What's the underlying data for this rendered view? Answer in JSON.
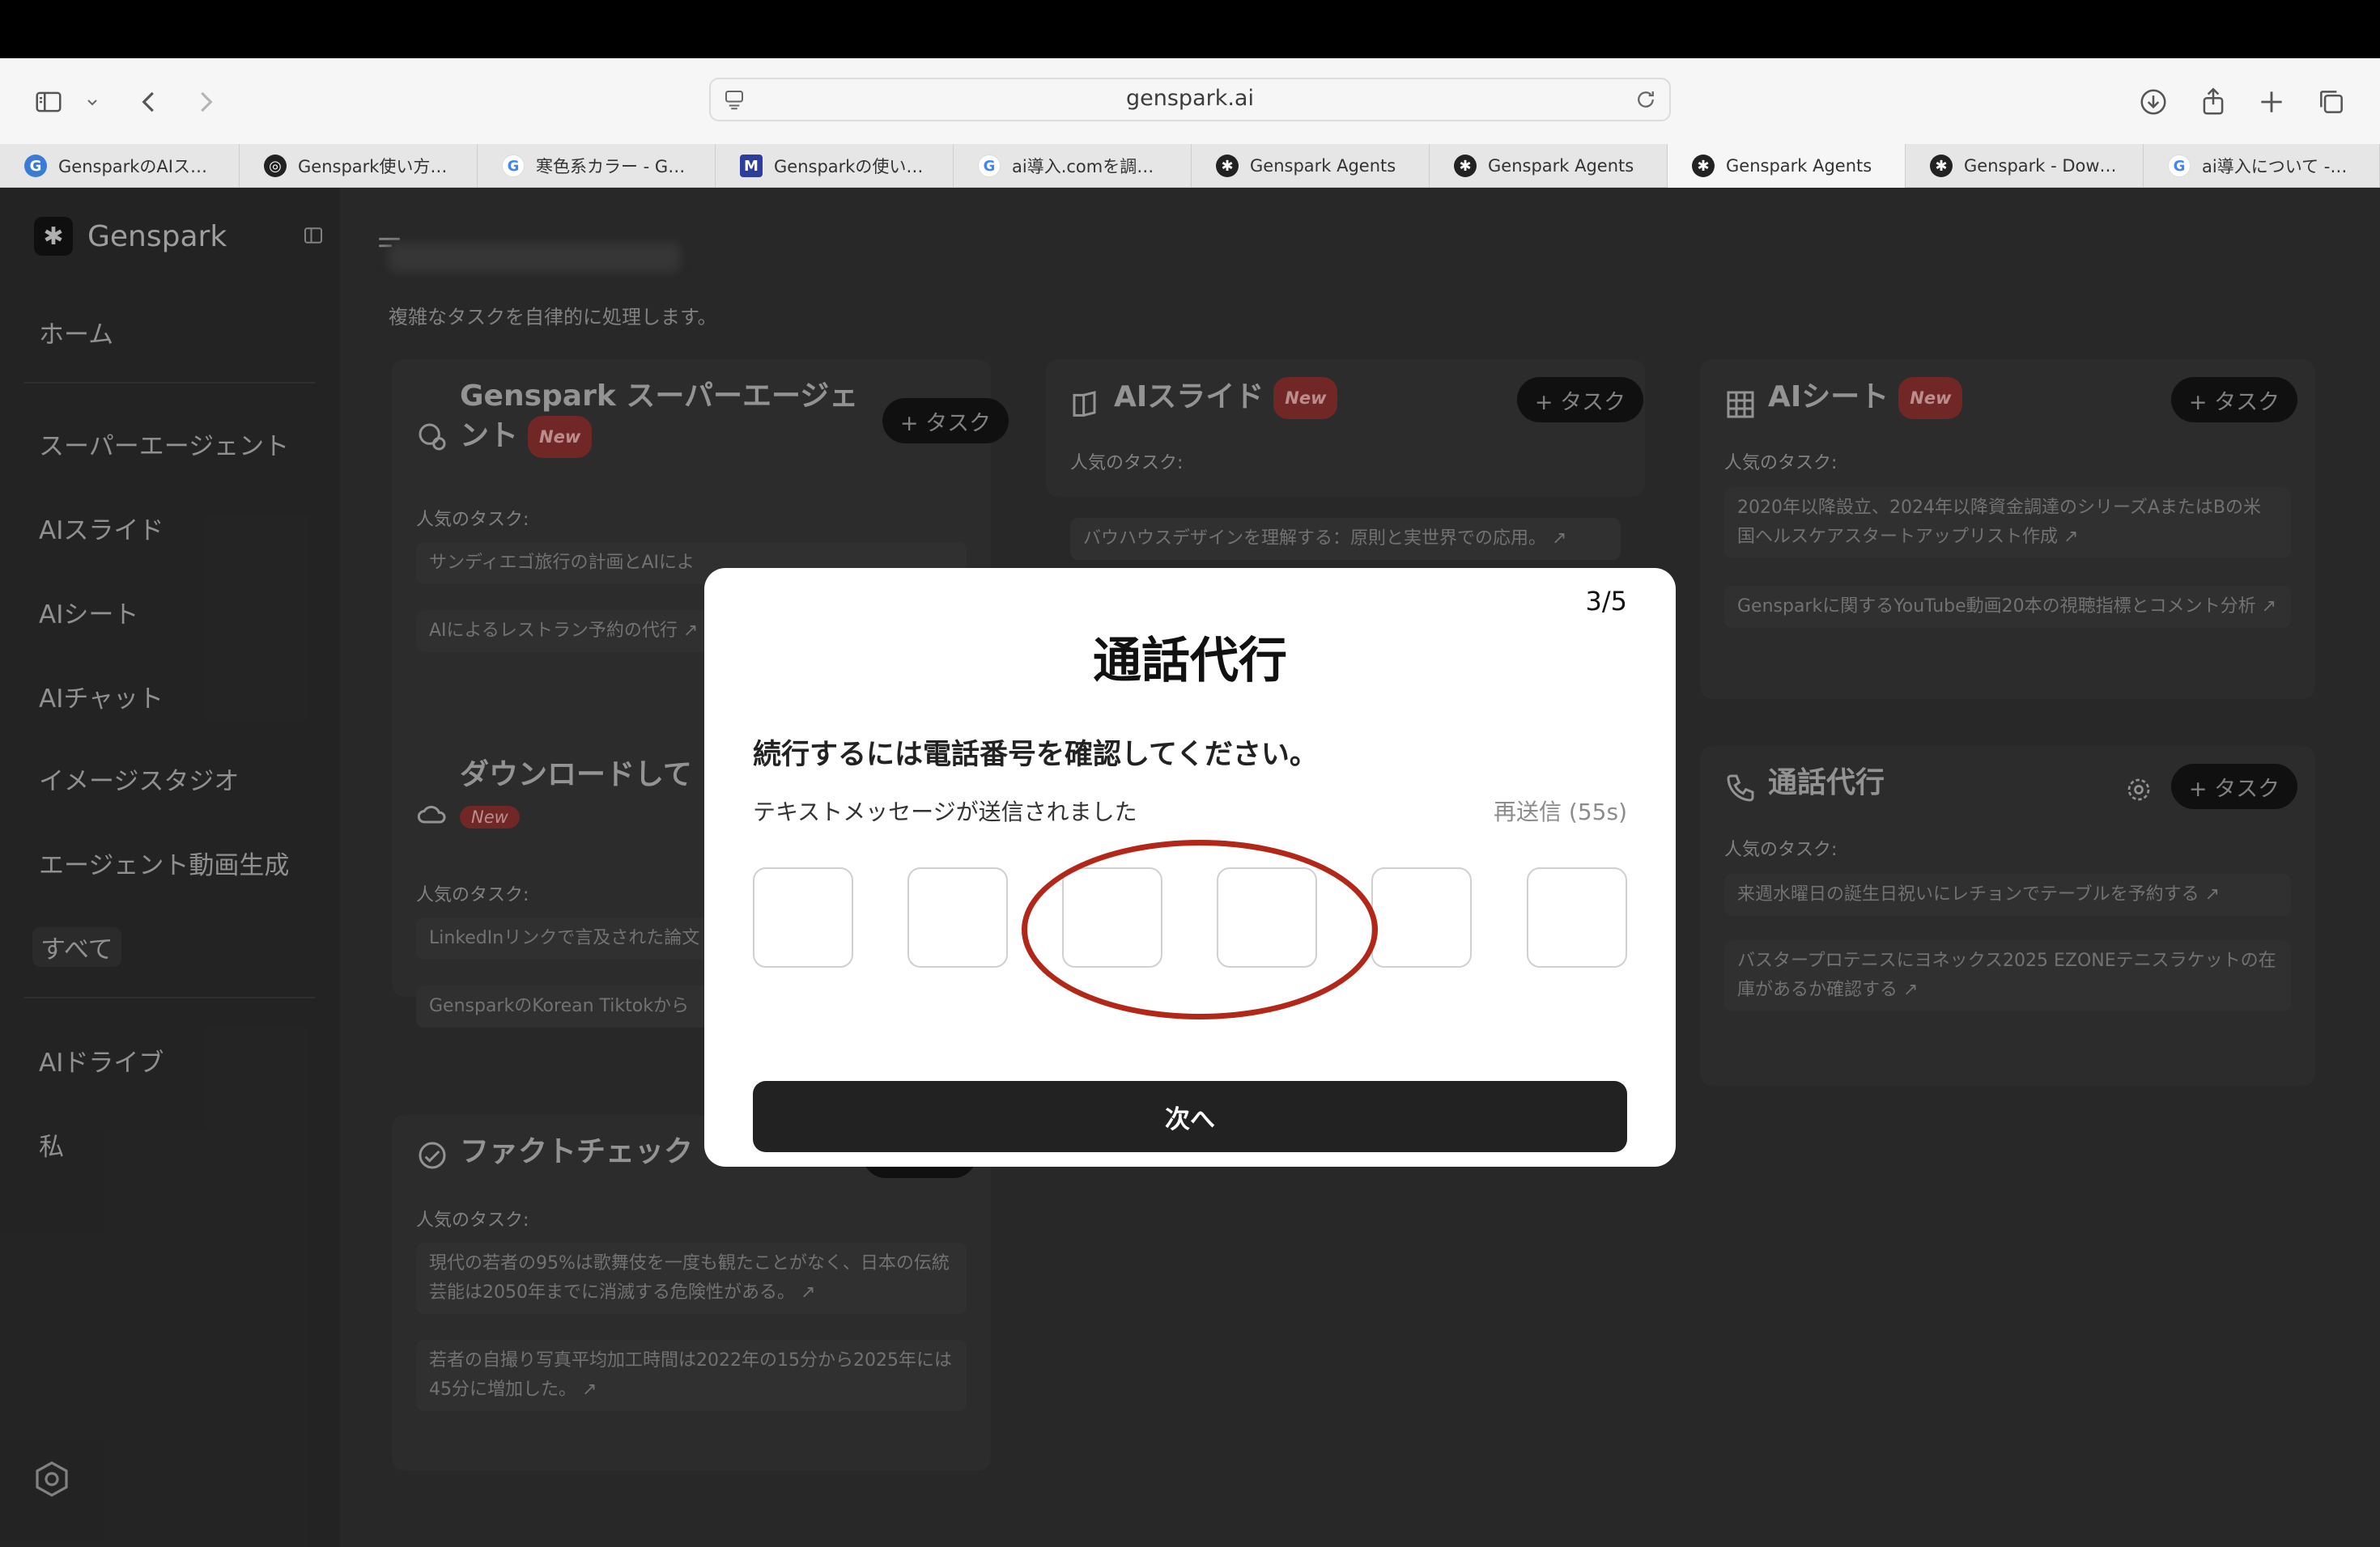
{
  "browser": {
    "url": "genspark.ai",
    "tabs": [
      {
        "title": "GensparkのAIス…",
        "icon": "genspark-doc-icon",
        "color": "#3a7bd5"
      },
      {
        "title": "Genspark使い方…",
        "icon": "chatgpt-icon",
        "color": "#222222"
      },
      {
        "title": "寒色系カラー - G…",
        "icon": "google-icon",
        "color": "#4285f4"
      },
      {
        "title": "Gensparkの使い…",
        "icon": "bookmark-icon",
        "color": "#2c3e9c"
      },
      {
        "title": "ai導入.comを調…",
        "icon": "google-icon",
        "color": "#4285f4"
      },
      {
        "title": "Genspark Agents",
        "icon": "genspark-icon",
        "color": "#222222"
      },
      {
        "title": "Genspark Agents",
        "icon": "genspark-icon",
        "color": "#222222"
      },
      {
        "title": "Genspark Agents",
        "icon": "genspark-icon",
        "color": "#222222"
      },
      {
        "title": "Genspark - Dow…",
        "icon": "genspark-icon",
        "color": "#222222"
      },
      {
        "title": "ai導入について -…",
        "icon": "google-icon",
        "color": "#4285f4"
      }
    ],
    "active_tab": 7
  },
  "sidebar": {
    "brand": "Genspark",
    "items": [
      {
        "label": "ホーム"
      },
      {
        "label": "スーパーエージェント"
      },
      {
        "label": "AIスライド"
      },
      {
        "label": "AIシート"
      },
      {
        "label": "AIチャット"
      },
      {
        "label": "イメージスタジオ"
      },
      {
        "label": "エージェント動画生成"
      },
      {
        "label": "すべて"
      },
      {
        "label": "AIドライブ"
      },
      {
        "label": "私"
      }
    ]
  },
  "main": {
    "subtitle": "複雑なタスクを自律的に処理します。",
    "popular_label": "人気のタスク:",
    "task_button": "+ タスク",
    "new_badge": "New",
    "cards": [
      {
        "title": "Genspark スーパーエージェント",
        "items": [
          "サンディエゴ旅行の計画とAIによ",
          "AIによるレストラン予約の代行 ↗"
        ]
      },
      {
        "title": "AIスライド",
        "items": [
          "バウハウスデザインを理解する：原則と実世界での応用。 ↗"
        ]
      },
      {
        "title": "AIシート",
        "items": [
          "2020年以降設立、2024年以降資金調達のシリーズAまたはBの米国ヘルスケアスタートアップリスト作成 ↗",
          "Gensparkに関するYouTube動画20本の視聴指標とコメント分析 ↗"
        ]
      },
      {
        "title": "ダウンロードして",
        "items": [
          "LinkedInリンクで言及された論文",
          "GensparkのKorean Tiktokから"
        ]
      },
      {
        "title": "通話代行",
        "items": [
          "来週水曜日の誕生日祝いにレチョンでテーブルを予約する ↗",
          "バスタープロテニスにヨネックス2025 EZONEテニスラケットの在庫があるか確認する ↗"
        ]
      },
      {
        "title": "ファクトチェック",
        "items": [
          "現代の若者の95%は歌舞伎を一度も観たことがなく、日本の伝統芸能は2050年までに消滅する危険性がある。 ↗",
          "若者の自撮り写真平均加工時間は2022年の15分から2025年には45分に増加した。 ↗"
        ]
      }
    ]
  },
  "modal": {
    "step": "3/5",
    "title": "通話代行",
    "prompt": "続行するには電話番号を確認してください。",
    "sent_text": "テキストメッセージが送信されました",
    "resend": "再送信 (55s)",
    "code_digits": [
      "",
      "",
      "",
      "",
      "",
      ""
    ],
    "next_button": "次へ",
    "annotation_color": "#b22718"
  }
}
